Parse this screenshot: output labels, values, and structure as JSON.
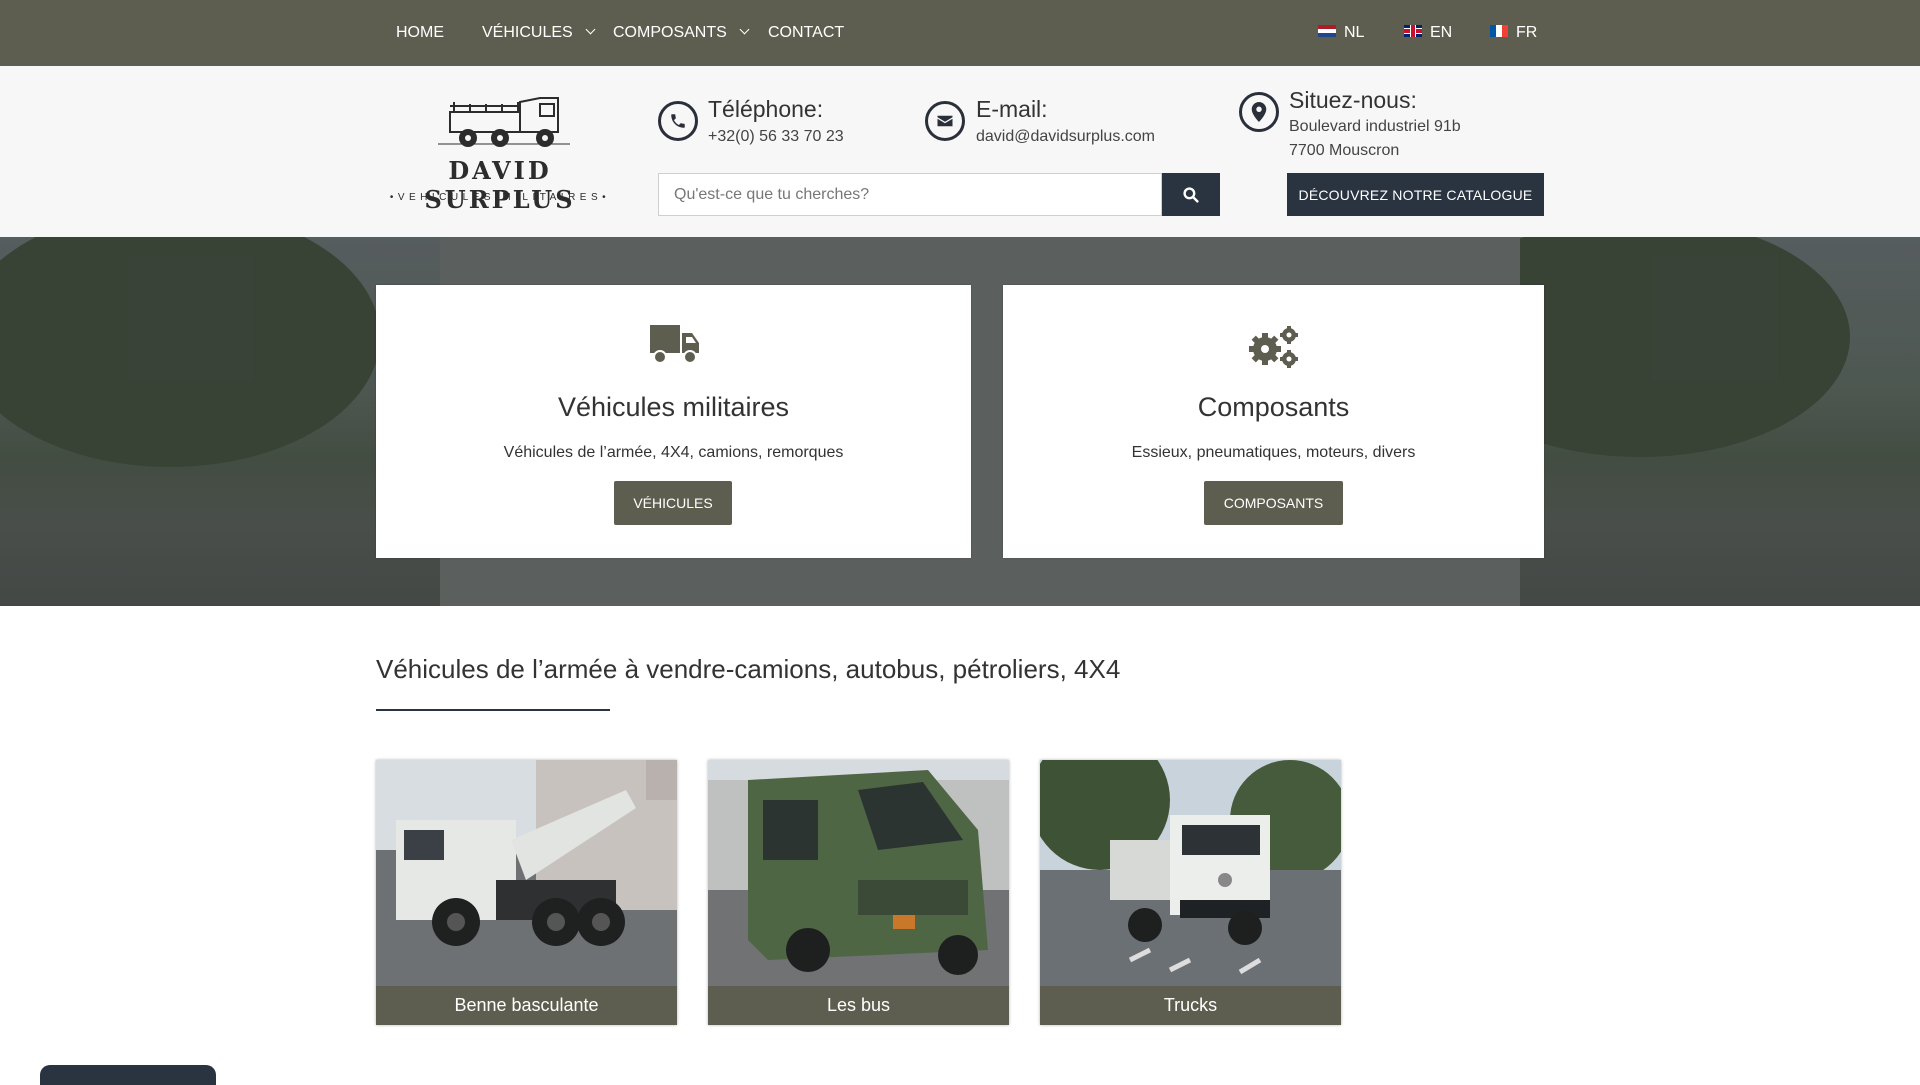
{
  "nav": {
    "items": [
      {
        "label": "HOME"
      },
      {
        "label": "VÉHICULES"
      },
      {
        "label": "COMPOSANTS"
      },
      {
        "label": "CONTACT"
      }
    ],
    "languages": [
      {
        "code": "NL"
      },
      {
        "code": "EN"
      },
      {
        "code": "FR"
      }
    ]
  },
  "header": {
    "logo": {
      "name": "DAVID SURPLUS",
      "tagline": "•VEHICULES MILITAIRES•"
    },
    "phone": {
      "title": "Téléphone:",
      "value": "+32(0) 56 33 70 23",
      "icon": "phone-icon"
    },
    "email": {
      "title": "E-mail:",
      "value": "david@davidsurplus.com",
      "icon": "envelope-icon"
    },
    "location": {
      "title": "Situez-nous:",
      "line1": "Boulevard industriel 91b",
      "line2": "7700 Mouscron",
      "icon": "map-marker-icon"
    },
    "search": {
      "placeholder": "Qu'est-ce que tu cherches?",
      "value": ""
    },
    "catalog_button": "DÉCOUVREZ NOTRE CATALOGUE"
  },
  "hero": {
    "cards": [
      {
        "icon": "truck-icon",
        "title": "Véhicules militaires",
        "text": "Véhicules de l’armée, 4X4, camions, remorques",
        "button": "VÉHICULES"
      },
      {
        "icon": "cogs-icon",
        "title": "Composants",
        "text": "Essieux, pneumatiques, moteurs, divers",
        "button": "COMPOSANTS"
      }
    ]
  },
  "section": {
    "title": "Véhicules de l’armée à vendre-camions, autobus, pétroliers, 4X4",
    "tiles": [
      {
        "label": "Benne basculante"
      },
      {
        "label": "Les bus"
      },
      {
        "label": "Trucks"
      }
    ]
  },
  "colors": {
    "nav_bg": "#5e5e50",
    "dark_navy": "#2a3340",
    "header_bg": "#f7f7f7",
    "button_olive": "#5e5e50"
  }
}
